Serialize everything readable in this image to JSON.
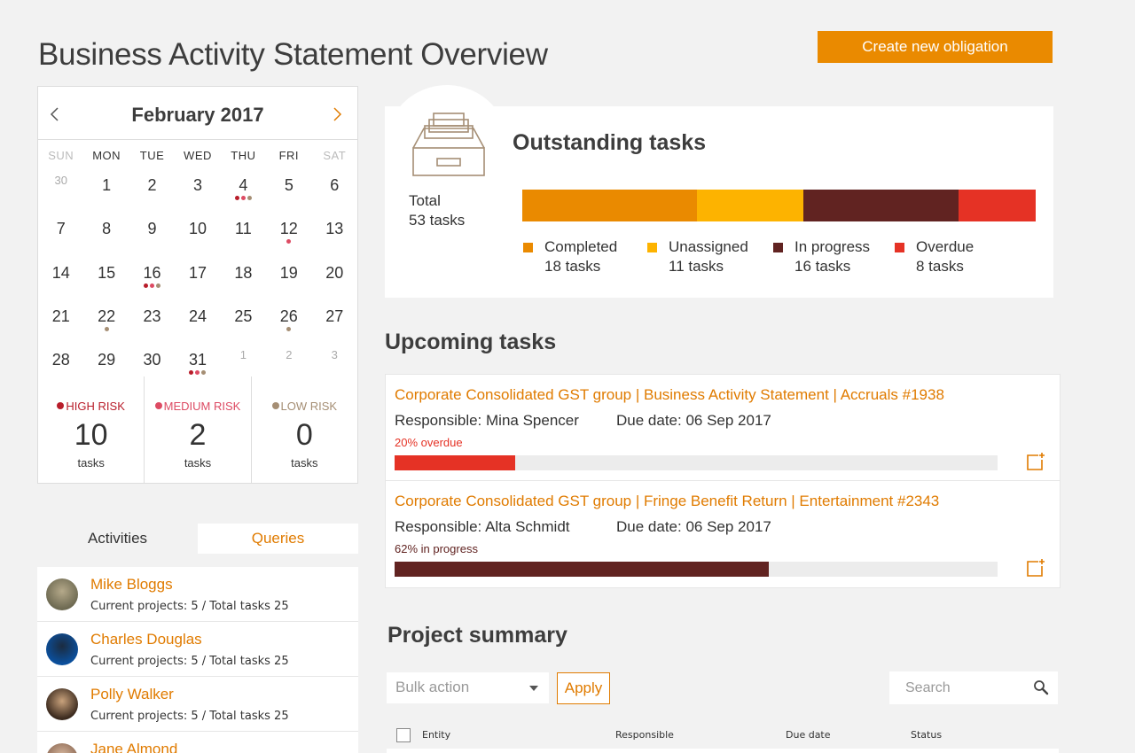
{
  "page_title": "Business Activity Statement Overview",
  "create_button": "Create new obligation",
  "colors": {
    "accent": "#ea8a00",
    "completed": "#ea8a00",
    "unassigned": "#fdb300",
    "in_progress": "#612321",
    "overdue": "#e53225",
    "high_risk": "#b81d2a",
    "medium_risk": "#dd4b63",
    "low_risk": "#a58e74"
  },
  "calendar": {
    "month": "February 2017",
    "days_of_week": [
      "SUN",
      "MON",
      "TUE",
      "WED",
      "THU",
      "FRI",
      "SAT"
    ],
    "weeks": [
      [
        {
          "d": "30",
          "dim": true
        },
        {
          "d": "1"
        },
        {
          "d": "2"
        },
        {
          "d": "3"
        },
        {
          "d": "4",
          "dots": [
            "high",
            "med",
            "low"
          ]
        },
        {
          "d": "5"
        },
        {
          "d": "6"
        }
      ],
      [
        {
          "d": "7"
        },
        {
          "d": "8"
        },
        {
          "d": "9"
        },
        {
          "d": "10"
        },
        {
          "d": "11"
        },
        {
          "d": "12",
          "dots": [
            "med"
          ]
        },
        {
          "d": "13"
        }
      ],
      [
        {
          "d": "14"
        },
        {
          "d": "15"
        },
        {
          "d": "16",
          "dots": [
            "high",
            "med",
            "low"
          ]
        },
        {
          "d": "17"
        },
        {
          "d": "18"
        },
        {
          "d": "19"
        },
        {
          "d": "20"
        }
      ],
      [
        {
          "d": "21"
        },
        {
          "d": "22",
          "dots": [
            "low"
          ]
        },
        {
          "d": "23"
        },
        {
          "d": "24"
        },
        {
          "d": "25"
        },
        {
          "d": "26",
          "dots": [
            "low"
          ]
        },
        {
          "d": "27"
        }
      ],
      [
        {
          "d": "28"
        },
        {
          "d": "29"
        },
        {
          "d": "30"
        },
        {
          "d": "31",
          "dots": [
            "high",
            "med",
            "low"
          ]
        },
        {
          "d": "1",
          "dim": true
        },
        {
          "d": "2",
          "dim": true
        },
        {
          "d": "3",
          "dim": true
        }
      ]
    ],
    "risk": [
      {
        "label": "HIGH RISK",
        "count": "10",
        "unit": "tasks",
        "level": "high"
      },
      {
        "label": "MEDIUM RISK",
        "count": "2",
        "unit": "tasks",
        "level": "med"
      },
      {
        "label": "LOW RISK",
        "count": "0",
        "unit": "tasks",
        "level": "low"
      }
    ]
  },
  "tabs": {
    "activities": "Activities",
    "queries": "Queries"
  },
  "people": [
    {
      "name": "Mike Bloggs",
      "meta": "Current projects: 5 / Total tasks 25",
      "avatar": [
        "#6e6a52",
        "#b5a98a"
      ]
    },
    {
      "name": "Charles Douglas",
      "meta": "Current projects: 5 / Total tasks 25",
      "avatar": [
        "#0b4f9c",
        "#1b2b3f"
      ]
    },
    {
      "name": "Polly Walker",
      "meta": "Current projects: 5 / Total tasks 25",
      "avatar": [
        "#3b2a1e",
        "#c9a27c"
      ]
    },
    {
      "name": "Jane Almond",
      "meta": "",
      "avatar": [
        "#8e6a55",
        "#d8b9a0"
      ]
    }
  ],
  "outstanding": {
    "title": "Outstanding tasks",
    "total_label": "Total",
    "total_value": "53 tasks",
    "segments": [
      {
        "name": "Completed",
        "count": 18,
        "label": "18 tasks",
        "key": "completed"
      },
      {
        "name": "Unassigned",
        "count": 11,
        "label": "11 tasks",
        "key": "unassigned"
      },
      {
        "name": "In progress",
        "count": 16,
        "label": "16 tasks",
        "key": "in_progress"
      },
      {
        "name": "Overdue",
        "count": 8,
        "label": "8 tasks",
        "key": "overdue"
      }
    ]
  },
  "upcoming": {
    "title": "Upcoming tasks",
    "tasks": [
      {
        "link": "Corporate Consolidated GST group |  Business Activity Statement  |  Accruals #1938",
        "responsible": "Responsible: Mina Spencer",
        "due": "Due date: 06 Sep 2017",
        "status": "20% overdue",
        "progress": 0.2,
        "key": "overdue"
      },
      {
        "link": "Corporate Consolidated GST group |  Fringe Benefit Return | Entertainment #2343",
        "responsible": "Responsible: Alta Schmidt",
        "due": "Due date: 06 Sep 2017",
        "status": "62% in progress",
        "progress": 0.62,
        "key": "in_progress"
      }
    ]
  },
  "project_summary": {
    "title": "Project summary",
    "bulk_action": "Bulk action",
    "apply": "Apply",
    "search_placeholder": "Search",
    "columns": [
      "Entity",
      "Responsible",
      "Due date",
      "Status"
    ]
  }
}
